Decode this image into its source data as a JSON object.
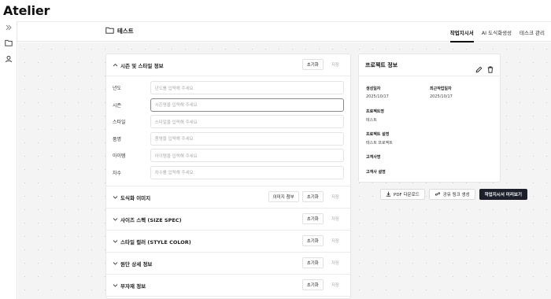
{
  "app": {
    "brand": "Atelier"
  },
  "sidebar": {
    "items": [
      {
        "icon": "chevrons-right-icon"
      },
      {
        "icon": "folder-icon"
      },
      {
        "icon": "user-icon"
      }
    ]
  },
  "header": {
    "breadcrumb": "테스트",
    "tabs": [
      {
        "label": "작업지시서",
        "active": true
      },
      {
        "label": "AI 도식화생성",
        "active": false
      },
      {
        "label": "테스크 관리",
        "active": false
      }
    ]
  },
  "basic_section": {
    "title": "시즌 및 스타일 정보",
    "reset_label": "초기화",
    "save_label": "저장",
    "fields": [
      {
        "label": "년도",
        "placeholder": "년도를 입력해 주세요"
      },
      {
        "label": "시즌",
        "placeholder": "시즌명을 입력해 주세요"
      },
      {
        "label": "스타일",
        "placeholder": "스타일을 입력해 주세요"
      },
      {
        "label": "품명",
        "placeholder": "품명을 입력해 주세요"
      },
      {
        "label": "아이템",
        "placeholder": "아이템을 입력해 주세요"
      },
      {
        "label": "차수",
        "placeholder": "차수를 입력해 주세요"
      }
    ]
  },
  "sections": [
    {
      "title": "도식화 이미지",
      "attach_label": "이미지 첨부",
      "reset_label": "초기화",
      "save_label": "저장"
    },
    {
      "title": "사이즈 스펙 (SIZE SPEC)",
      "reset_label": "초기화",
      "save_label": "저장"
    },
    {
      "title": "스타일 컬러 (STYLE COLOR)",
      "reset_label": "초기화",
      "save_label": "저장"
    },
    {
      "title": "원단 상세 정보",
      "reset_label": "초기화",
      "save_label": "저장"
    },
    {
      "title": "부자재 정보",
      "reset_label": "초기화",
      "save_label": "저장"
    }
  ],
  "project_info": {
    "title": "프로젝트 정보",
    "created_label": "생성일자",
    "created_value": "2025/10/17",
    "modified_label": "최근작업일자",
    "modified_value": "2025/10/17",
    "name_label": "프로젝트명",
    "name_value": "테스트",
    "desc_label": "프로젝트 설명",
    "desc_value": "테스트 프로젝트",
    "client_label": "고객사명",
    "client_desc_label": "고객사 설명"
  },
  "actions": {
    "pdf_label": "PDF 다운로드",
    "share_label": "공유 링크 생성",
    "preview_label": "작업지시서 미리보기"
  }
}
